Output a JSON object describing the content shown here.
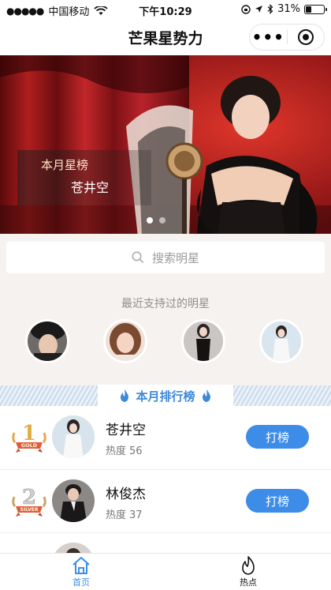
{
  "status_bar": {
    "carrier": "中国移动",
    "time": "下午10:29",
    "battery": "31%"
  },
  "nav": {
    "title": "芒果星势力",
    "more_label": "•••"
  },
  "banner": {
    "caption_title": "本月星榜",
    "caption_name": "苍井空",
    "slide_count": 2,
    "active_slide": 1
  },
  "search": {
    "placeholder": "搜索明星"
  },
  "recent": {
    "title": "最近支持过的明星",
    "avatar_count": 4
  },
  "ranking": {
    "title": "本月排行榜",
    "heat_label": "热度",
    "vote_label": "打榜",
    "items": [
      {
        "rank": 1,
        "medal": "GOLD",
        "name": "苍井空",
        "heat": "56"
      },
      {
        "rank": 2,
        "medal": "SILVER",
        "name": "林俊杰",
        "heat": "37"
      }
    ]
  },
  "tabbar": {
    "tabs": [
      {
        "label": "首页",
        "icon": "home-icon",
        "active": true
      },
      {
        "label": "热点",
        "icon": "flame-icon",
        "active": false
      }
    ]
  },
  "colors": {
    "accent": "#3d8de8",
    "page_bg": "#f6f2f0",
    "rank_title": "#3c88d9"
  }
}
